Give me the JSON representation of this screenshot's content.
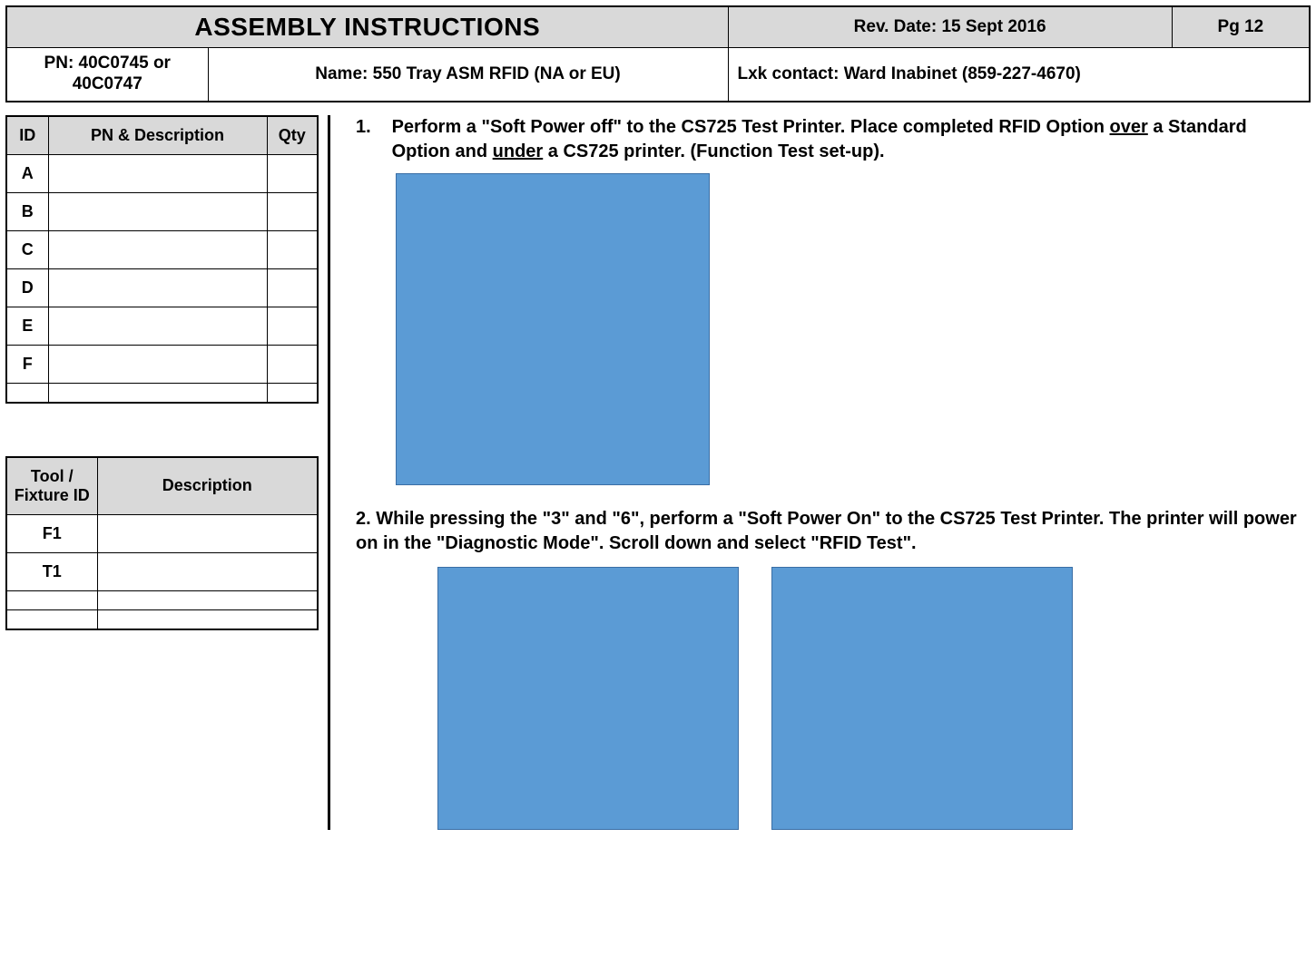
{
  "header": {
    "title": "ASSEMBLY INSTRUCTIONS",
    "rev": "Rev. Date: 15 Sept 2016",
    "page": "Pg  12",
    "pn": "PN:  40C0745 or 40C0747",
    "name": "Name:  550 Tray ASM RFID (NA or EU)",
    "contact": "Lxk contact: Ward Inabinet (859-227-4670)"
  },
  "parts_table": {
    "headers": {
      "id": "ID",
      "desc": "PN & Description",
      "qty": "Qty"
    },
    "rows": [
      {
        "id": "A",
        "desc": "",
        "qty": ""
      },
      {
        "id": "B",
        "desc": "",
        "qty": ""
      },
      {
        "id": "C",
        "desc": "",
        "qty": ""
      },
      {
        "id": "D",
        "desc": "",
        "qty": ""
      },
      {
        "id": "E",
        "desc": "",
        "qty": ""
      },
      {
        "id": "F",
        "desc": "",
        "qty": ""
      },
      {
        "id": "",
        "desc": "",
        "qty": ""
      }
    ]
  },
  "tools_table": {
    "headers": {
      "tid": "Tool / Fixture ID",
      "desc": "Description"
    },
    "rows": [
      {
        "tid": "F1",
        "desc": ""
      },
      {
        "tid": "T1",
        "desc": ""
      },
      {
        "tid": "",
        "desc": ""
      },
      {
        "tid": "",
        "desc": ""
      }
    ]
  },
  "steps": {
    "s1_lead": "1.",
    "s1_a": "Perform a \"Soft Power off\" to the CS725 Test Printer. Place completed RFID Option ",
    "s1_over": "over",
    "s1_b": " a Standard Option and ",
    "s1_under": "under",
    "s1_c": " a CS725 printer.    (Function Test set-up).",
    "s2": "2. While pressing the \"3\" and \"6\", perform a \"Soft Power On\" to the CS725 Test Printer.  The printer will power on in the \"Diagnostic Mode\".   Scroll down and select \"RFID Test\"."
  }
}
